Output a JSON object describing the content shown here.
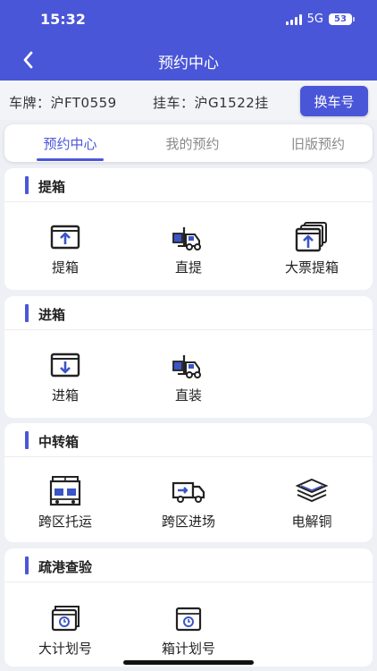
{
  "status_bar": {
    "time": "15:32",
    "network": "5G",
    "battery": "53"
  },
  "header": {
    "title": "预约中心"
  },
  "vehicle": {
    "plate_text": "车牌：沪FT0559",
    "trailer_text": "挂车：沪G1522挂",
    "switch_button": "换车号"
  },
  "tabs": [
    {
      "label": "预约中心",
      "active": true
    },
    {
      "label": "我的预约",
      "active": false
    },
    {
      "label": "旧版预约",
      "active": false
    }
  ],
  "sections": [
    {
      "title": "提箱",
      "items": [
        {
          "label": "提箱",
          "icon": "box-up-icon"
        },
        {
          "label": "直提",
          "icon": "forklift-icon"
        },
        {
          "label": "大票提箱",
          "icon": "stacked-boxes-up-icon"
        }
      ]
    },
    {
      "title": "进箱",
      "items": [
        {
          "label": "进箱",
          "icon": "box-down-icon"
        },
        {
          "label": "直装",
          "icon": "forklift-icon"
        }
      ]
    },
    {
      "title": "中转箱",
      "items": [
        {
          "label": "跨区托运",
          "icon": "warehouse-icon"
        },
        {
          "label": "跨区进场",
          "icon": "truck-icon"
        },
        {
          "label": "电解铜",
          "icon": "copper-plates-icon"
        }
      ]
    },
    {
      "title": "疏港查验",
      "items": [
        {
          "label": "大计划号",
          "icon": "box-clock-stack-icon"
        },
        {
          "label": "箱计划号",
          "icon": "box-clock-icon"
        }
      ]
    }
  ],
  "colors": {
    "primary": "#4a56d8",
    "background": "#eef0f6"
  }
}
